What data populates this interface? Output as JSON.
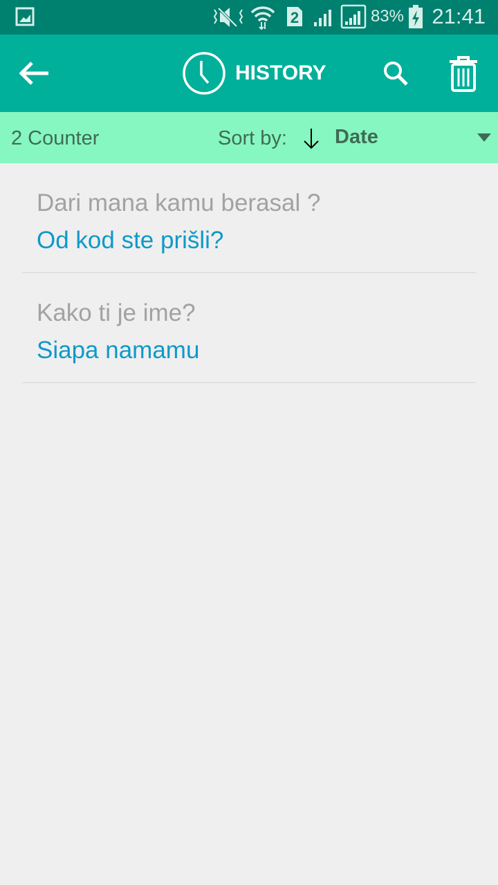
{
  "status_bar": {
    "battery": "83%",
    "time": "21:41",
    "icons": [
      "gallery-icon",
      "mute-vibrate-icon",
      "wifi-icon",
      "sim2-icon",
      "signal-icon",
      "signal-icon",
      "battery-charging-icon"
    ]
  },
  "app_bar": {
    "title": "HISTORY",
    "colors": {
      "background": "#00b09b",
      "status": "#00806f"
    }
  },
  "sort_bar": {
    "counter": "2 Counter",
    "sort_label": "Sort by:",
    "sort_value": "Date",
    "background": "#86f7c0"
  },
  "history": [
    {
      "source": "Dari mana kamu berasal ?",
      "translation": "Od kod ste prišli?"
    },
    {
      "source": "Kako ti je ime?",
      "translation": "Siapa namamu"
    }
  ]
}
